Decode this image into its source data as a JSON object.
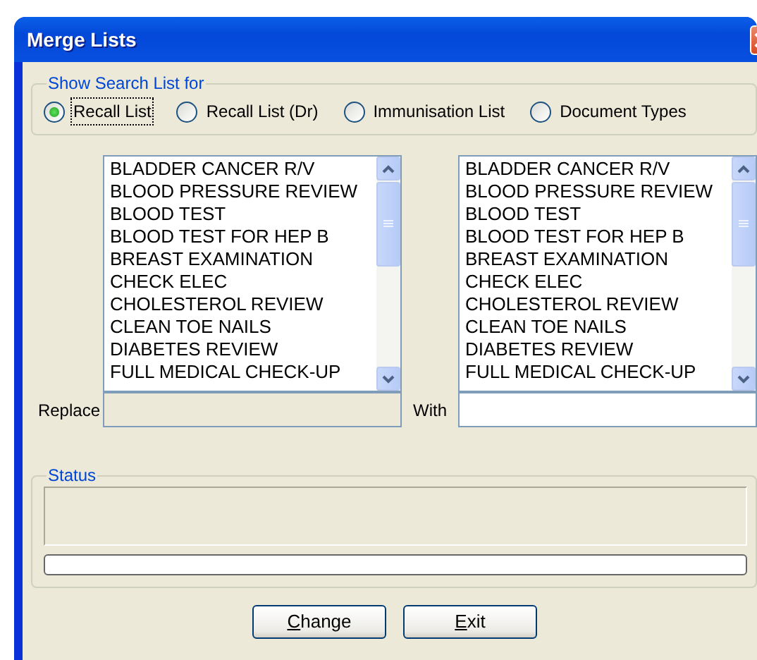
{
  "window": {
    "title": "Merge Lists"
  },
  "search_group": {
    "title": "Show Search List for",
    "options": [
      {
        "label": "Recall List",
        "selected": true,
        "focused": true
      },
      {
        "label": "Recall List (Dr)",
        "selected": false,
        "focused": false
      },
      {
        "label": "Immunisation List",
        "selected": false,
        "focused": false
      },
      {
        "label": "Document Types",
        "selected": false,
        "focused": false
      }
    ]
  },
  "lists": [
    {
      "items": [
        "BLADDER CANCER R/V",
        "BLOOD PRESSURE REVIEW",
        "BLOOD TEST",
        "BLOOD TEST FOR HEP B",
        "BREAST EXAMINATION",
        "CHECK ELEC",
        "CHOLESTEROL REVIEW",
        "CLEAN TOE NAILS",
        "DIABETES REVIEW",
        "FULL MEDICAL CHECK-UP"
      ],
      "field_label": "Replace",
      "field_disabled": true
    },
    {
      "items": [
        "BLADDER CANCER R/V",
        "BLOOD PRESSURE REVIEW",
        "BLOOD TEST",
        "BLOOD TEST FOR HEP B",
        "BREAST EXAMINATION",
        "CHECK ELEC",
        "CHOLESTEROL REVIEW",
        "CLEAN TOE NAILS",
        "DIABETES REVIEW",
        "FULL MEDICAL CHECK-UP"
      ],
      "field_label": "With",
      "field_disabled": false
    }
  ],
  "status_group": {
    "title": "Status",
    "level": 0
  },
  "buttons": [
    {
      "label": "Change",
      "underline_first": true
    },
    {
      "label": "Exit",
      "underline_first": true
    }
  ]
}
